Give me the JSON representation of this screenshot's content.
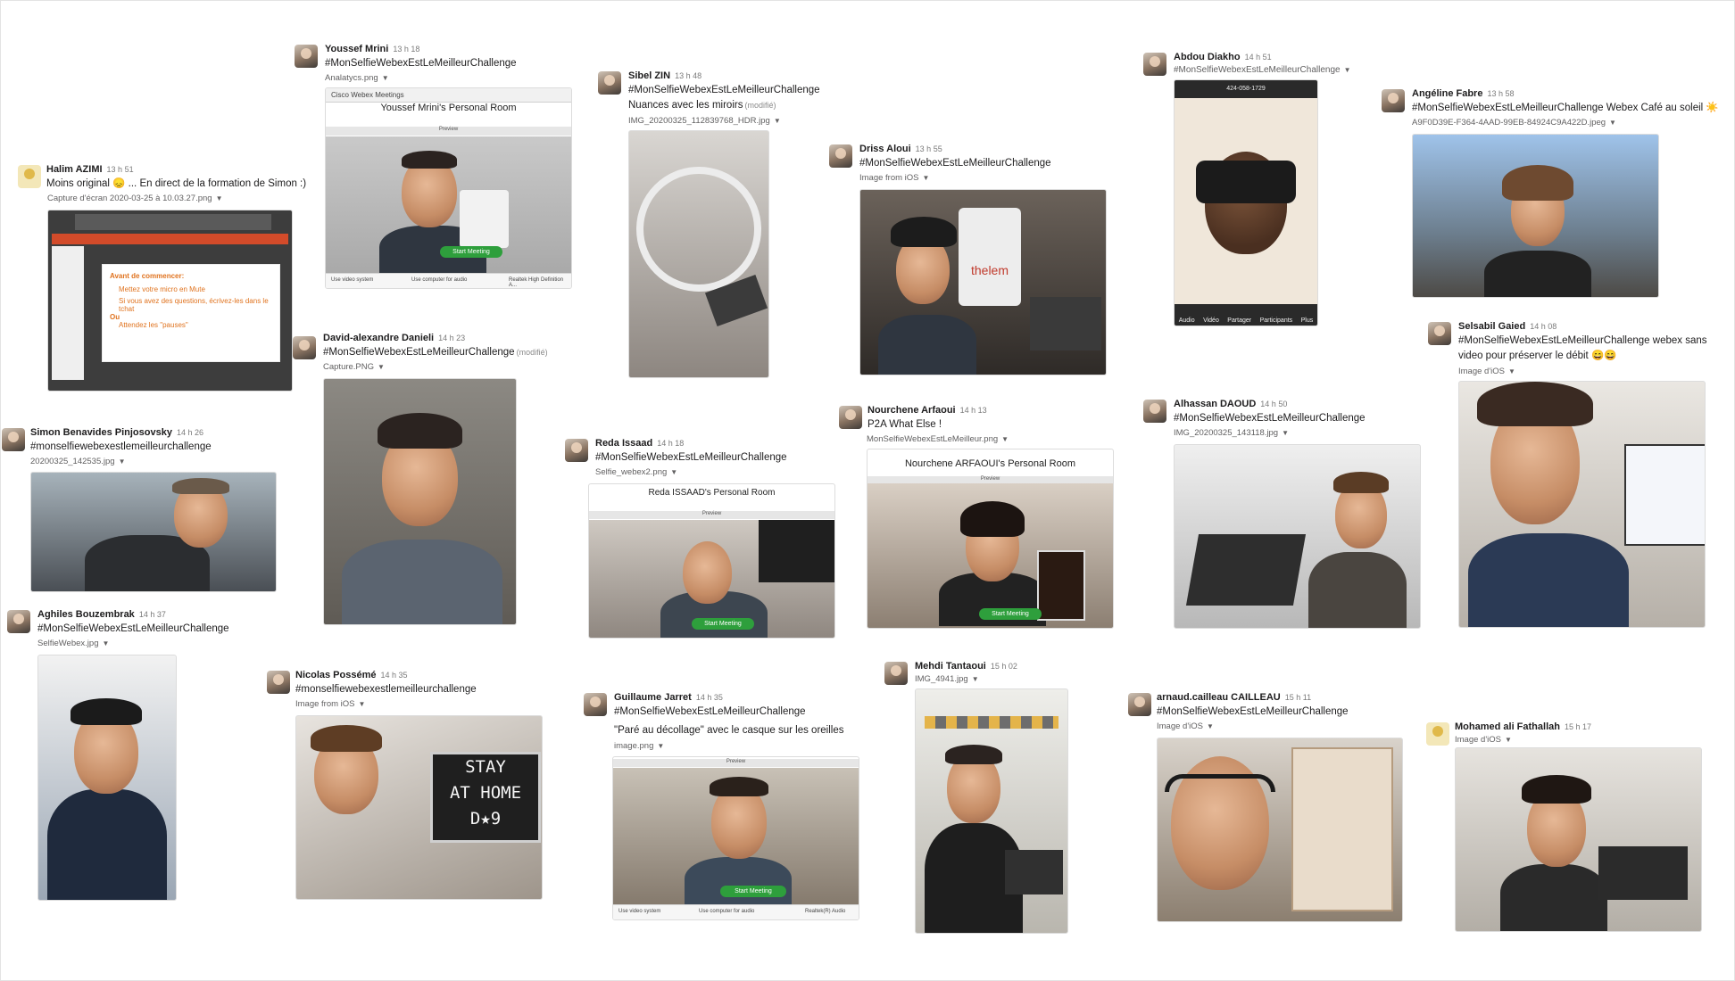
{
  "posts": {
    "halim": {
      "name": "Halim AZIMI",
      "time": "13 h 51",
      "text": "Moins original 😞 ... En direct de la formation de Simon :)",
      "file": "Capture d'écran 2020-03-25 à 10.03.27.png",
      "slide_title": "Avant de commencer:",
      "slide_b1": "Mettez votre micro en Mute",
      "slide_b2": "Si vous avez des questions, écrivez-les dans le tchat",
      "slide_ou": "Ou",
      "slide_b3": "Attendez les \"pauses\""
    },
    "youssef": {
      "name": "Youssef Mrini",
      "time": "13 h 18",
      "text": "#MonSelfieWebexEstLeMeilleurChallenge",
      "file": "Analatycs.png",
      "app": "Cisco Webex Meetings",
      "room": "Youssef Mrini's Personal Room",
      "preview": "Preview",
      "start": "Start Meeting",
      "foot1": "Use video system",
      "foot2": "Use computer for audio",
      "foot3": "Realtek High Definition A..."
    },
    "sibel": {
      "name": "Sibel ZIN",
      "time": "13 h 48",
      "text": "#MonSelfieWebexEstLeMeilleurChallenge",
      "text2": "Nuances avec les miroirs",
      "edited": "(modifié)",
      "file": "IMG_20200325_112839768_HDR.jpg"
    },
    "driss": {
      "name": "Driss Aloui",
      "time": "13 h 55",
      "text": "#MonSelfieWebexEstLeMeilleurChallenge",
      "file": "Image from iOS",
      "bag": "thelem"
    },
    "abdou": {
      "name": "Abdou Diakho",
      "time": "14 h 51",
      "text": "#MonSelfieWebexEstLeMeilleurChallenge",
      "phone": "424-058-1729",
      "tabs": [
        "Audio",
        "Vidéo",
        "Partager",
        "Participants",
        "Plus"
      ]
    },
    "angeline": {
      "name": "Angéline Fabre",
      "time": "13 h 58",
      "text": "#MonSelfieWebexEstLeMeilleurChallenge Webex Café au soleil ☀️",
      "file": "A9F0D39E-F364-4AAD-99EB-84924C9A422D.jpeg"
    },
    "david": {
      "name": "David-alexandre Danieli",
      "time": "14 h 23",
      "text": "#MonSelfieWebexEstLeMeilleurChallenge",
      "edited": "(modifié)",
      "file": "Capture.PNG"
    },
    "simon": {
      "name": "Simon Benavides Pinjosovsky",
      "time": "14 h 26",
      "text": "#monselfiewebexestlemeilleurchallenge",
      "file": "20200325_142535.jpg"
    },
    "reda": {
      "name": "Reda Issaad",
      "time": "14 h 18",
      "text": "#MonSelfieWebexEstLeMeilleurChallenge",
      "file": "Selfie_webex2.png",
      "room": "Reda ISSAAD's Personal Room",
      "preview": "Preview",
      "start": "Start Meeting"
    },
    "nourchene": {
      "name": "Nourchene Arfaoui",
      "time": "14 h 13",
      "text": "P2A What Else !",
      "file": "MonSelfieWebexEstLeMeilleur.png",
      "room": "Nourchene ARFAOUI's Personal Room",
      "preview": "Preview",
      "start": "Start Meeting"
    },
    "alhassan": {
      "name": "Alhassan DAOUD",
      "time": "14 h 50",
      "text": "#MonSelfieWebexEstLeMeilleurChallenge",
      "file": "IMG_20200325_143118.jpg"
    },
    "selsabil": {
      "name": "Selsabil Gaied",
      "time": "14 h 08",
      "text": "#MonSelfieWebexEstLeMeilleurChallenge webex sans",
      "text2": "video pour préserver le débit 😄😄",
      "file": "Image d'iOS"
    },
    "aghiles": {
      "name": "Aghiles Bouzembrak",
      "time": "14 h 37",
      "text": "#MonSelfieWebexEstLeMeilleurChallenge",
      "file": "SelfieWebex.jpg"
    },
    "nicolas": {
      "name": "Nicolas Possémé",
      "time": "14 h 35",
      "text": "#monselfiewebexestlemeilleurchallenge",
      "file": "Image from iOS",
      "board1": "STAY",
      "board2": "AT HOME",
      "board3": "D★9"
    },
    "guillaume": {
      "name": "Guillaume Jarret",
      "time": "14 h 35",
      "text": "#MonSelfieWebexEstLeMeilleurChallenge",
      "text2": "\"Paré au décollage\" avec le casque sur les oreilles",
      "file": "image.png",
      "preview": "Preview",
      "start": "Start Meeting",
      "foot1": "Use video system",
      "foot2": "Use computer for audio",
      "foot3": "Realtek(R) Audio"
    },
    "mehdi": {
      "name": "Mehdi Tantaoui",
      "time": "15 h 02",
      "file": "IMG_4941.jpg"
    },
    "arnaud": {
      "name": "arnaud.cailleau CAILLEAU",
      "time": "15 h 11",
      "text": "#MonSelfieWebexEstLeMeilleurChallenge",
      "file": "Image d'iOS"
    },
    "mohamed": {
      "name": "Mohamed ali Fathallah",
      "time": "15 h 17",
      "file": "Image d'iOS"
    }
  }
}
